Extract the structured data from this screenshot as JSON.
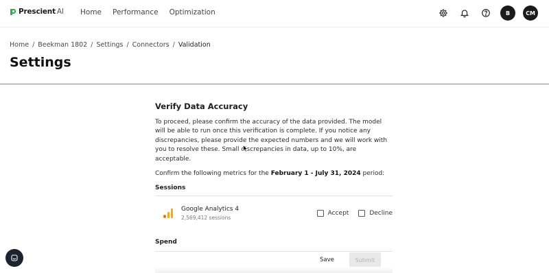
{
  "brand": {
    "name": "Prescient",
    "suffix": "AI",
    "accent": "#2bb24c"
  },
  "nav": {
    "items": [
      "Home",
      "Performance",
      "Optimization"
    ]
  },
  "header_icons": [
    "gear-icon",
    "bell-icon",
    "help-icon"
  ],
  "avatars": [
    "B",
    "CM"
  ],
  "breadcrumb": [
    "Home",
    "Beekman 1802",
    "Settings",
    "Connectors",
    "Validation"
  ],
  "page": {
    "title": "Settings"
  },
  "panel": {
    "title": "Verify Data Accuracy",
    "description": "To proceed, please confirm the accuracy of the data provided. The model will be able to run once this verification is complete. If you notice any discrepancies, please provide the expected numbers and we will work with you to resolve these. Small discrepancies in data, up to 10%, are acceptable.",
    "confirm_prefix": "Confirm the following metrics for the",
    "date_range": "February 1 - July 31, 2024",
    "confirm_suffix": "period:",
    "sections": {
      "sessions": {
        "label": "Sessions",
        "source": "Google Analytics 4",
        "value": "2,569,412 sessions",
        "accept_label": "Accept",
        "decline_label": "Decline"
      },
      "spend": {
        "label": "Spend"
      }
    },
    "actions": {
      "save": "Save",
      "submit": "Submit"
    }
  },
  "colors": {
    "ga_orange": "#f9ab00",
    "ga_dark": "#e37400",
    "fab": "#1d2430"
  }
}
